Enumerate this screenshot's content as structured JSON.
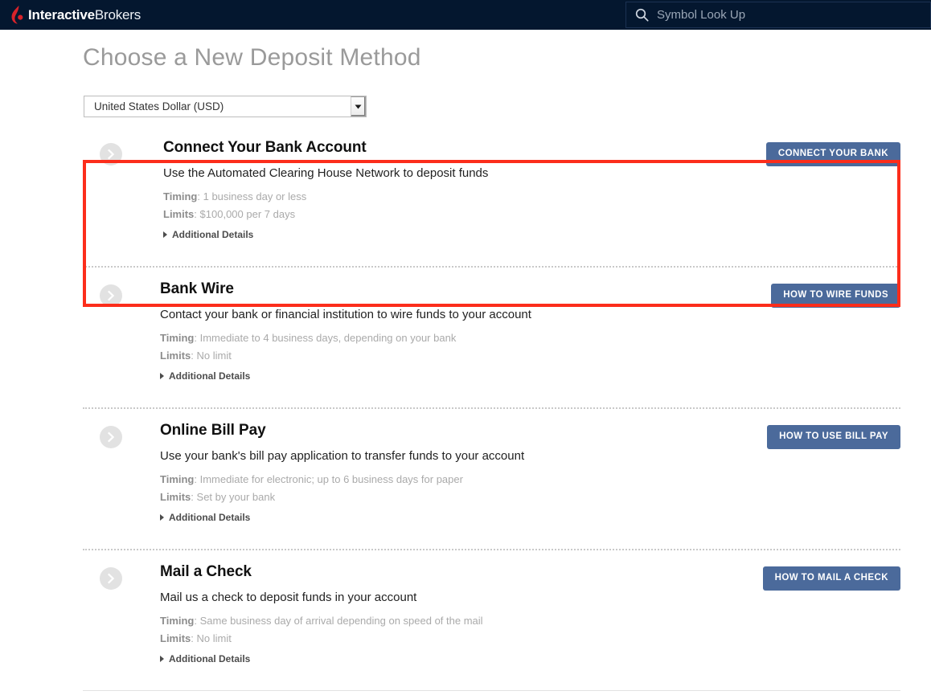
{
  "topnav": {
    "brand_bold": "Interactive",
    "brand_light": "Brokers",
    "brand_mark_icon": "ib-flame-logo-icon",
    "search": {
      "icon": "search-icon",
      "placeholder": "Symbol Look Up",
      "value": ""
    },
    "background_color": "#04172f"
  },
  "page": {
    "title": "Choose a New Deposit Method",
    "currency": {
      "selected": "United States Dollar (USD)",
      "options": [
        "United States Dollar (USD)"
      ],
      "arrow_icon": "chevron-down-icon"
    },
    "highlight": {
      "color": "#fc2d1b",
      "target": "Connect Your Bank Account"
    }
  },
  "methods": [
    {
      "id": "connect-your-bank-account",
      "arrow_icon": "chevron-right-circle-icon",
      "title": "Connect Your Bank Account",
      "description": "Use the Automated Clearing House Network to deposit funds",
      "timing_label": "Timing",
      "timing_value": "1 business day or less",
      "limits_label": "Limits",
      "limits_value": "$100,000 per 7 days",
      "details_label": "Additional Details",
      "cta_label": "CONNECT YOUR BANK",
      "highlighted": true
    },
    {
      "id": "bank-wire",
      "arrow_icon": "chevron-right-circle-icon",
      "title": "Bank Wire",
      "description": "Contact your bank or financial institution to wire funds to your account",
      "timing_label": "Timing",
      "timing_value": "Immediate to 4 business days, depending on your bank",
      "limits_label": "Limits",
      "limits_value": "No limit",
      "details_label": "Additional Details",
      "cta_label": "HOW TO WIRE FUNDS",
      "highlighted": false
    },
    {
      "id": "online-bill-pay",
      "arrow_icon": "chevron-right-circle-icon",
      "title": "Online Bill Pay",
      "description": "Use your bank's bill pay application to transfer funds to your account",
      "timing_label": "Timing",
      "timing_value": "Immediate for electronic; up to 6 business days for paper",
      "limits_label": "Limits",
      "limits_value": "Set by your bank",
      "details_label": "Additional Details",
      "cta_label": "HOW TO USE BILL PAY",
      "highlighted": false
    },
    {
      "id": "mail-a-check",
      "arrow_icon": "chevron-right-circle-icon",
      "title": "Mail a Check",
      "description": "Mail us a check to deposit funds in your account",
      "timing_label": "Timing",
      "timing_value": "Same business day of arrival depending on speed of the mail",
      "limits_label": "Limits",
      "limits_value": "No limit",
      "details_label": "Additional Details",
      "cta_label": "HOW TO MAIL A CHECK",
      "highlighted": false
    }
  ],
  "colors": {
    "accent_button": "#4b6a9b",
    "brand_red": "#d8232a",
    "highlight_red": "#fc2d1b",
    "nav_background": "#04172f"
  }
}
